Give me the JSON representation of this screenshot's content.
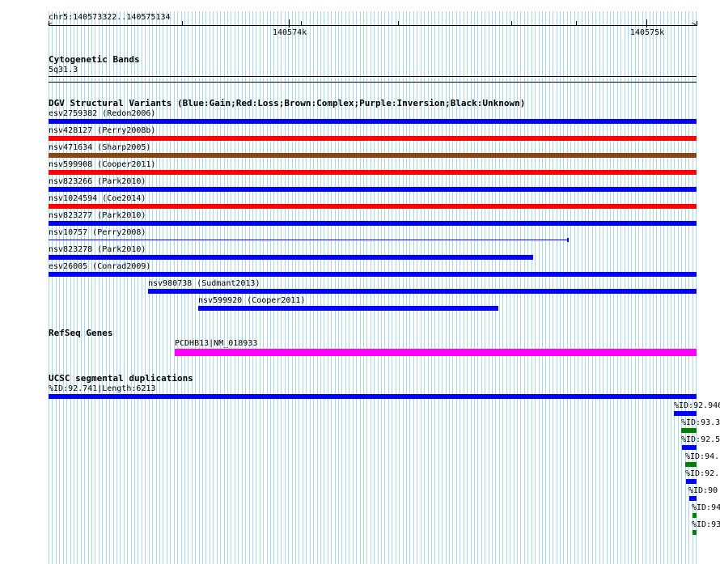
{
  "ruler": {
    "locus": "chr5:140573322..140575134",
    "tick_1": "140574k",
    "tick_2": "140575k"
  },
  "colors": {
    "gain": "#0000ff",
    "loss": "#ff0000",
    "complex": "#8b4513",
    "refseq": "#ff00ff",
    "segdup_green": "#008000",
    "grid_line": "#a8d8e8"
  },
  "cytoband": {
    "title": "Cytogenetic Bands",
    "band": "5q31.3"
  },
  "dgv": {
    "title": "DGV Structural Variants (Blue:Gain;Red:Loss;Brown:Complex;Purple:Inversion;Black:Unknown)",
    "variants": [
      {
        "label": "esv2759382 (Redon2006)",
        "type": "gain"
      },
      {
        "label": "nsv428127 (Perry2008b)",
        "type": "loss"
      },
      {
        "label": "nsv471634 (Sharp2005)",
        "type": "complex"
      },
      {
        "label": "nsv599908 (Cooper2011)",
        "type": "loss"
      },
      {
        "label": "nsv823266 (Park2010)",
        "type": "gain"
      },
      {
        "label": "nsv1024594 (Coe2014)",
        "type": "loss"
      },
      {
        "label": "nsv823277 (Park2010)",
        "type": "gain"
      },
      {
        "label": "nsv10757 (Perry2008)",
        "type": "gain"
      },
      {
        "label": "nsv823278 (Park2010)",
        "type": "gain"
      },
      {
        "label": "esv26005 (Conrad2009)",
        "type": "gain"
      },
      {
        "label": "nsv980738 (Sudmant2013)",
        "type": "gain"
      },
      {
        "label": "nsv599920 (Cooper2011)",
        "type": "gain"
      }
    ]
  },
  "refseq": {
    "title": "RefSeq Genes",
    "gene": "PCDHB13|NM_018933"
  },
  "segdup": {
    "title": "UCSC segmental duplications",
    "items": [
      {
        "label": "%ID:92.741|Length:6213",
        "color": "blue"
      },
      {
        "label": "%ID:92.946",
        "color": "blue"
      },
      {
        "label": "%ID:93.3",
        "color": "green"
      },
      {
        "label": "%ID:92.5",
        "color": "blue"
      },
      {
        "label": "%ID:94.",
        "color": "green"
      },
      {
        "label": "%ID:92.",
        "color": "blue"
      },
      {
        "label": "%ID:90",
        "color": "blue"
      },
      {
        "label": "%ID:94",
        "color": "green"
      },
      {
        "label": "%ID:93",
        "color": "green"
      }
    ]
  }
}
